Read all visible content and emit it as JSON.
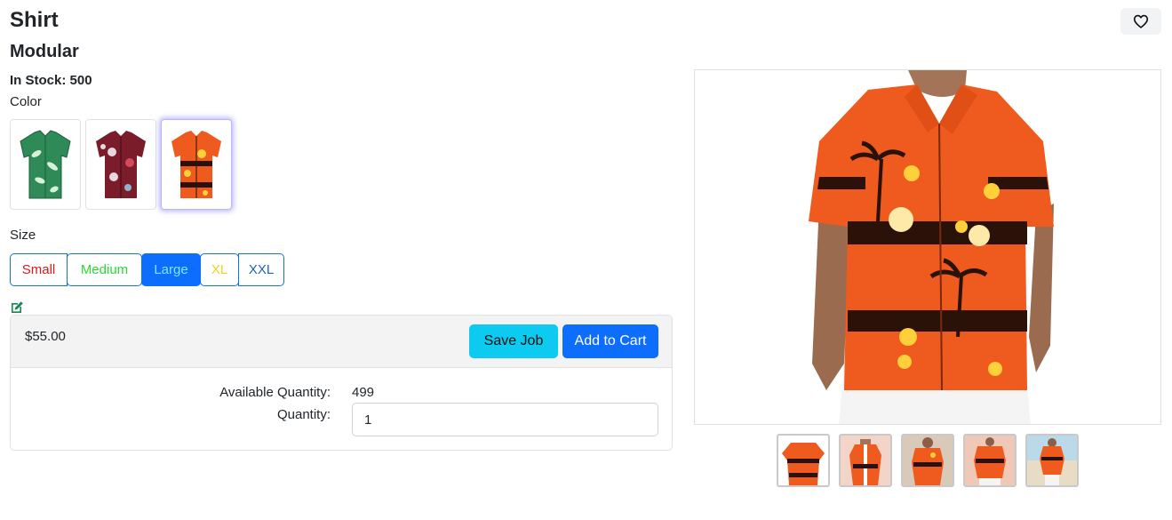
{
  "product": {
    "name": "Shirt",
    "brand": "Modular",
    "stock_text": "In Stock: 500"
  },
  "color": {
    "label": "Color",
    "options": [
      {
        "name": "green-leaf-shirt",
        "main": "#2e8b57",
        "accent": "#d8f0dc"
      },
      {
        "name": "maroon-floral-shirt",
        "main": "#7a1c2a",
        "accent": "#e7d7e0"
      },
      {
        "name": "orange-sunset-shirt",
        "main": "#ef5a1f",
        "accent": "#2a1208"
      }
    ],
    "selected_index": 2
  },
  "size": {
    "label": "Size",
    "options": [
      {
        "label": "Small",
        "color": "#d91a1a"
      },
      {
        "label": "Medium",
        "color": "#2bd934"
      },
      {
        "label": "Large",
        "color": "#7fe7ff"
      },
      {
        "label": "XL",
        "color": "#f2d21b"
      },
      {
        "label": "XXL",
        "color": "#1f5fc4"
      }
    ],
    "selected": "Large"
  },
  "purchase": {
    "price": "$55.00",
    "save_label": "Save Job",
    "cart_label": "Add to Cart",
    "available_label": "Available Quantity:",
    "available_value": "499",
    "quantity_label": "Quantity:",
    "quantity_value": "1"
  },
  "gallery": {
    "thumbnail_count": 5
  },
  "icons": {
    "favorite": "heart-icon",
    "edit": "edit-icon"
  },
  "colors": {
    "primary": "#0d6efd",
    "info": "#0dcaf0",
    "shirt_orange": "#ef5a1f",
    "edit_green": "#198754"
  }
}
